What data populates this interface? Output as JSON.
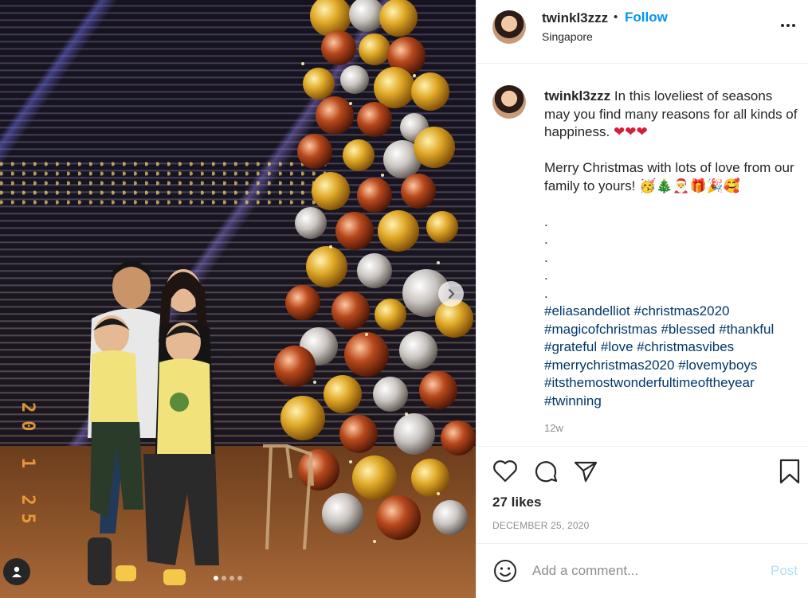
{
  "post": {
    "username": "twinkl3zzz",
    "separator": "•",
    "follow_label": "Follow",
    "location": "Singapore",
    "caption": {
      "username": "twinkl3zzz",
      "line1": "In this loveliest of seasons may you find many reasons for all kinds of happiness.",
      "hearts": "❤❤❤",
      "line2": "Merry Christmas with lots of love from our family to yours!",
      "emojis": "🥳🎄🎅🎁🎉🥰",
      "dots": [
        ".",
        ".",
        ".",
        ".",
        "."
      ],
      "hashtags": [
        "#eliasandelliot",
        "#christmas2020",
        "#magicofchristmas",
        "#blessed",
        "#thankful",
        "#grateful",
        "#love",
        "#christmasvibes",
        "#merrychristmas2020",
        "#lovemyboys",
        "#itsthemostwonderfultimeoftheyear",
        "#twinning"
      ]
    },
    "time_ago": "12w",
    "likes": "27 likes",
    "date": "DECEMBER 25, 2020",
    "comment_placeholder": "Add a comment...",
    "post_label": "Post",
    "photo_timestamp": "20 1 25",
    "carousel": {
      "count": 4,
      "active": 0
    }
  },
  "icons": {
    "more": "more-options-icon",
    "like": "heart-icon",
    "comment": "comment-bubble-icon",
    "share": "paper-plane-icon",
    "save": "bookmark-icon",
    "emoji": "smiley-icon",
    "next": "chevron-right-icon",
    "tag": "user-tag-icon"
  },
  "colors": {
    "accent": "#0095f6",
    "hashtag": "#00376b",
    "muted": "#8e8e8e",
    "post_disabled": "#b2dffc"
  }
}
